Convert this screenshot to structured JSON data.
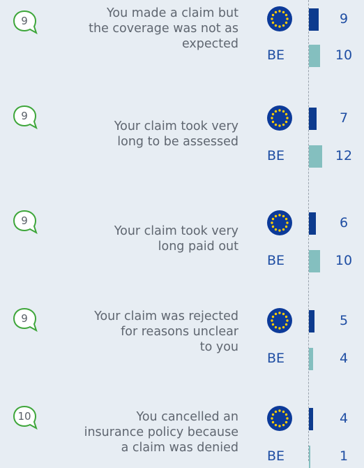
{
  "colors": {
    "eu_bar": "#0d3b8e",
    "be_bar": "#84bfbf",
    "value_text": "#1f4ea3",
    "question_text": "#5f6670",
    "bubble_green": "#3ea63a",
    "flag_blue": "#0c3a99",
    "flag_star": "#ffcc00"
  },
  "icons": {
    "question_bubble": "speech-bubble-icon",
    "eu": "eu-flag-icon"
  },
  "labels": {
    "be": "BE"
  },
  "chart_data": {
    "type": "bar",
    "orientation": "horizontal",
    "categories": [
      "You made a claim but\nthe coverage was not as\nexpected",
      "Your claim took very\nlong to be assessed",
      "Your claim took very\nlong paid out",
      "Your claim was rejected\nfor reasons unclear\nto you",
      "You cancelled an\ninsurance policy because\na claim was denied"
    ],
    "question_numbers": [
      "9",
      "9",
      "9",
      "9",
      "10"
    ],
    "series": [
      {
        "name": "EU",
        "values": [
          9,
          7,
          6,
          5,
          4
        ]
      },
      {
        "name": "BE",
        "values": [
          10,
          12,
          10,
          4,
          1
        ]
      }
    ]
  }
}
